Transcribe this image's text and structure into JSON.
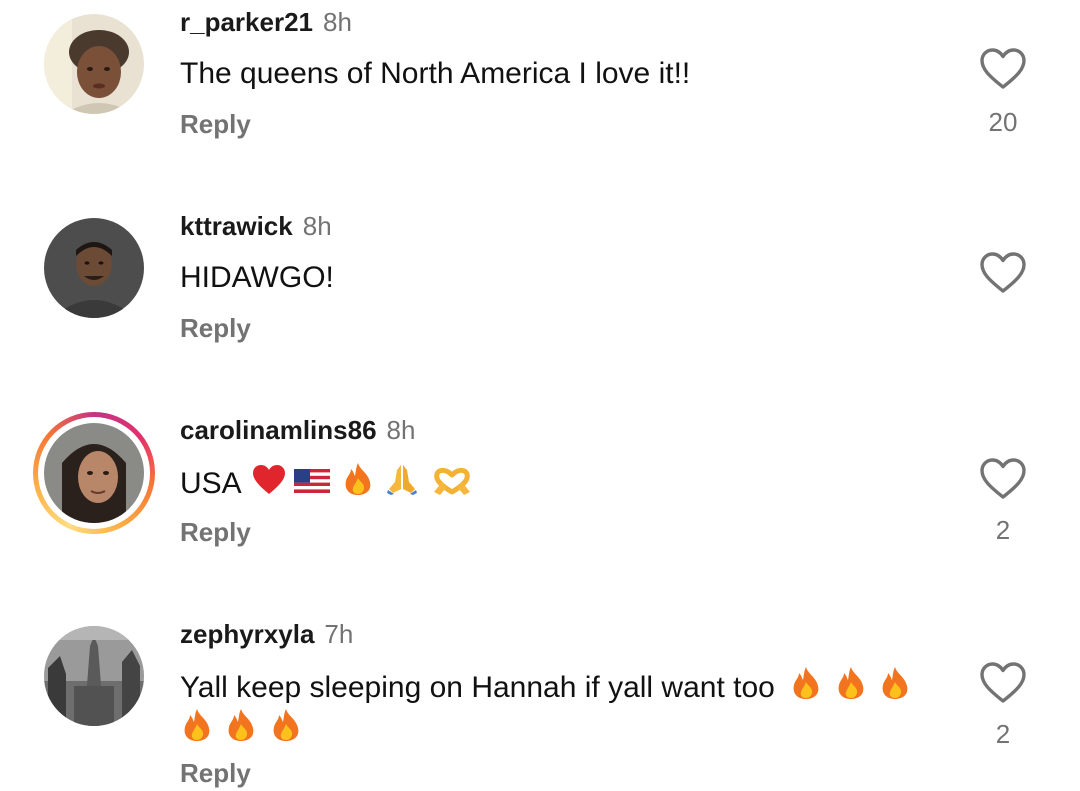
{
  "comments": [
    {
      "username": "r_parker21",
      "time": "8h",
      "text": "The queens of North America I love it!!",
      "reply_label": "Reply",
      "likes": "20",
      "story_ring": false
    },
    {
      "username": "kttrawick",
      "time": "8h",
      "text": "HIDAWGO!",
      "reply_label": "Reply",
      "likes": "",
      "story_ring": false
    },
    {
      "username": "carolinamlins86",
      "time": "8h",
      "text": "USA",
      "emojis": [
        "red-heart",
        "us-flag",
        "fire",
        "folded-hands",
        "heart-hands"
      ],
      "reply_label": "Reply",
      "likes": "2",
      "story_ring": true
    },
    {
      "username": "zephyrxyla",
      "time": "7h",
      "text_line1": "Yall keep sleeping on Hannah if yall want too",
      "emojis_line1": [
        "fire",
        "fire",
        "fire"
      ],
      "emojis_line2": [
        "fire",
        "fire",
        "fire"
      ],
      "reply_label": "Reply",
      "likes": "2",
      "story_ring": false
    }
  ],
  "colors": {
    "username": "#1a1a1a",
    "secondary": "#737373",
    "story_ring_start": "#c13584",
    "story_ring_end": "#fcaf45",
    "heart_outline": "#737373"
  },
  "icons": {
    "like": "heart-outline-icon",
    "fire": "fire-emoji",
    "red_heart": "red-heart-emoji",
    "flag": "us-flag-emoji",
    "pray": "folded-hands-emoji",
    "heart_hands": "heart-hands-emoji"
  }
}
